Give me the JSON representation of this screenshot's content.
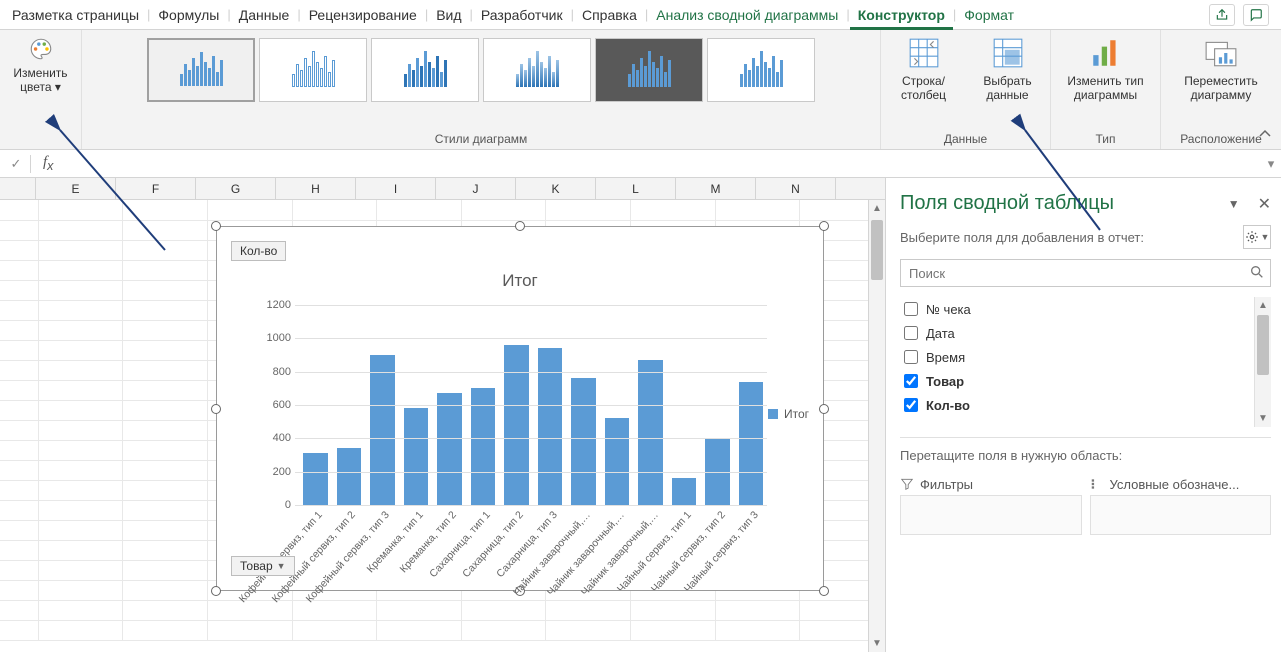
{
  "tabs": {
    "page_layout": "Разметка страницы",
    "formulas": "Формулы",
    "data": "Данные",
    "review": "Рецензирование",
    "view": "Вид",
    "developer": "Разработчик",
    "help": "Справка",
    "pivot_analyze": "Анализ сводной диаграммы",
    "design": "Конструктор",
    "format": "Формат"
  },
  "ribbon": {
    "change_colors_l1": "Изменить",
    "change_colors_l2": "цвета",
    "styles_label": "Стили диаграмм",
    "switch_rc_l1": "Строка/",
    "switch_rc_l2": "столбец",
    "select_data_l1": "Выбрать",
    "select_data_l2": "данные",
    "data_label": "Данные",
    "change_type_l1": "Изменить тип",
    "change_type_l2": "диаграммы",
    "type_label": "Тип",
    "move_chart_l1": "Переместить",
    "move_chart_l2": "диаграмму",
    "location_label": "Расположение"
  },
  "columns": [
    "E",
    "F",
    "G",
    "H",
    "I",
    "J",
    "K",
    "L",
    "M",
    "N"
  ],
  "chart": {
    "value_button": "Кол-во",
    "axis_button": "Товар",
    "legend": "Итог"
  },
  "chart_data": {
    "type": "bar",
    "title": "Итог",
    "ylabel": "",
    "xlabel": "",
    "ylim": [
      0,
      1200
    ],
    "yticks": [
      0,
      200,
      400,
      600,
      800,
      1000,
      1200
    ],
    "categories": [
      "Кофейный сервиз, тип 1",
      "Кофейный сервиз, тип 2",
      "Кофейный сервиз, тип 3",
      "Креманка, тип 1",
      "Креманка, тип 2",
      "Сахарница, тип 1",
      "Сахарница, тип 2",
      "Сахарница, тип 3",
      "Чайник заварочный,…",
      "Чайник заварочный,…",
      "Чайник заварочный,…",
      "Чайный сервиз, тип 1",
      "Чайный сервиз, тип 2",
      "Чайный сервиз, тип 3"
    ],
    "values": [
      310,
      340,
      900,
      580,
      670,
      700,
      960,
      940,
      760,
      520,
      870,
      160,
      400,
      740
    ],
    "series_name": "Итог"
  },
  "taskpane": {
    "title": "Поля сводной таблицы",
    "select_hint": "Выберите поля для добавления в отчет:",
    "search_placeholder": "Поиск",
    "fields": [
      {
        "label": "№ чека",
        "checked": false
      },
      {
        "label": "Дата",
        "checked": false
      },
      {
        "label": "Время",
        "checked": false
      },
      {
        "label": "Товар",
        "checked": true
      },
      {
        "label": "Кол-во",
        "checked": true
      }
    ],
    "drag_hint": "Перетащите поля в нужную область:",
    "filters_label": "Фильтры",
    "legend_label": "Условные обозначе..."
  }
}
